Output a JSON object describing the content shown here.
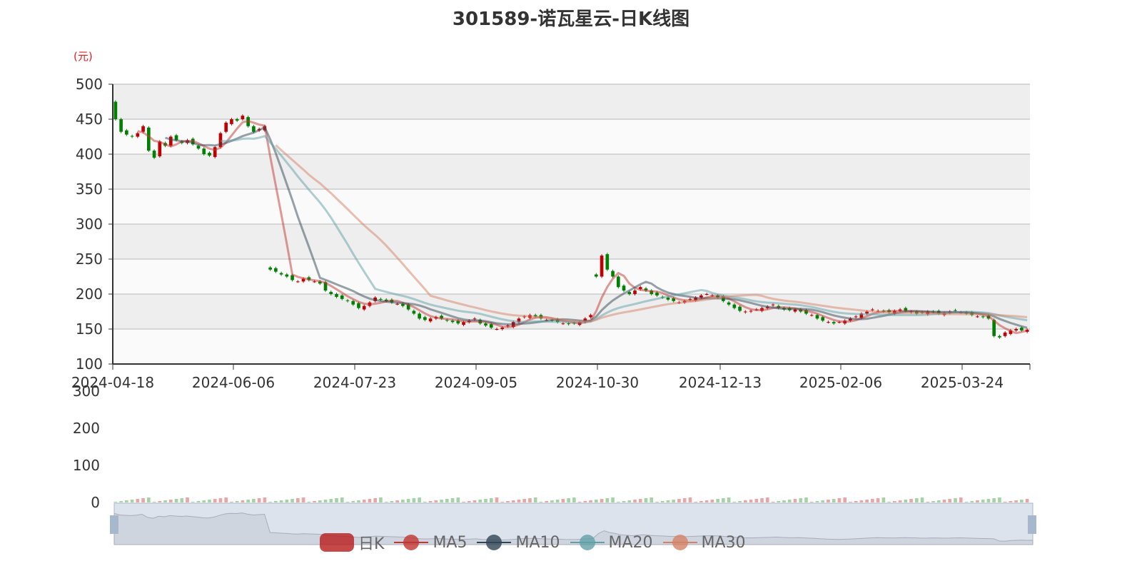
{
  "title": "301589-诺瓦星云-日K线图",
  "unit": "(元)",
  "legend": [
    {
      "name": "日K",
      "color": "#b81c1c"
    },
    {
      "name": "MA5",
      "color": "#c23531"
    },
    {
      "name": "MA10",
      "color": "#2f4554"
    },
    {
      "name": "MA20",
      "color": "#61a0a8"
    },
    {
      "name": "MA30",
      "color": "#d48265"
    }
  ],
  "chart_data": {
    "type": "candlestick",
    "title": "301589-诺瓦星云-日K线图",
    "ylabel": "(元)",
    "ylim": [
      100,
      500
    ],
    "yticks": [
      100,
      150,
      200,
      250,
      300,
      350,
      400,
      450,
      500
    ],
    "xticks": [
      "2024-04-18",
      "2024-06-06",
      "2024-07-23",
      "2024-09-05",
      "2024-10-30",
      "2024-12-13",
      "2025-02-06",
      "2025-03-24"
    ],
    "volume_ylim": [
      0,
      300
    ],
    "volume_yticks": [
      0,
      100,
      200,
      300
    ],
    "up_color": "#c00000",
    "down_color": "#008000",
    "close": [
      450,
      432,
      428,
      425,
      430,
      440,
      405,
      395,
      418,
      412,
      425,
      420,
      416,
      420,
      414,
      408,
      400,
      398,
      410,
      430,
      445,
      450,
      448,
      455,
      440,
      432,
      436,
      440,
      235,
      232,
      228,
      225,
      220,
      218,
      222,
      220,
      218,
      215,
      205,
      200,
      196,
      193,
      190,
      185,
      180,
      183,
      188,
      195,
      192,
      190,
      188,
      186,
      183,
      178,
      172,
      165,
      163,
      165,
      167,
      165,
      162,
      160,
      158,
      160,
      162,
      165,
      158,
      155,
      152,
      150,
      152,
      155,
      160,
      165,
      168,
      170,
      168,
      165,
      163,
      162,
      160,
      158,
      157,
      158,
      160,
      165,
      170,
      225,
      255,
      235,
      225,
      210,
      205,
      200,
      205,
      210,
      205,
      200,
      198,
      195,
      192,
      190,
      188,
      190,
      193,
      195,
      198,
      200,
      198,
      195,
      190,
      185,
      180,
      176,
      175,
      176,
      178,
      180,
      182,
      185,
      180,
      178,
      177,
      178,
      175,
      172,
      170,
      165,
      162,
      160,
      158,
      160,
      162,
      165,
      168,
      172,
      175,
      178,
      176,
      175,
      174,
      176,
      178,
      176,
      175,
      172,
      173,
      175,
      174,
      172,
      173,
      175,
      176,
      174,
      172,
      170,
      168,
      167,
      165,
      140,
      138,
      145,
      148,
      150,
      148,
      149
    ]
  }
}
